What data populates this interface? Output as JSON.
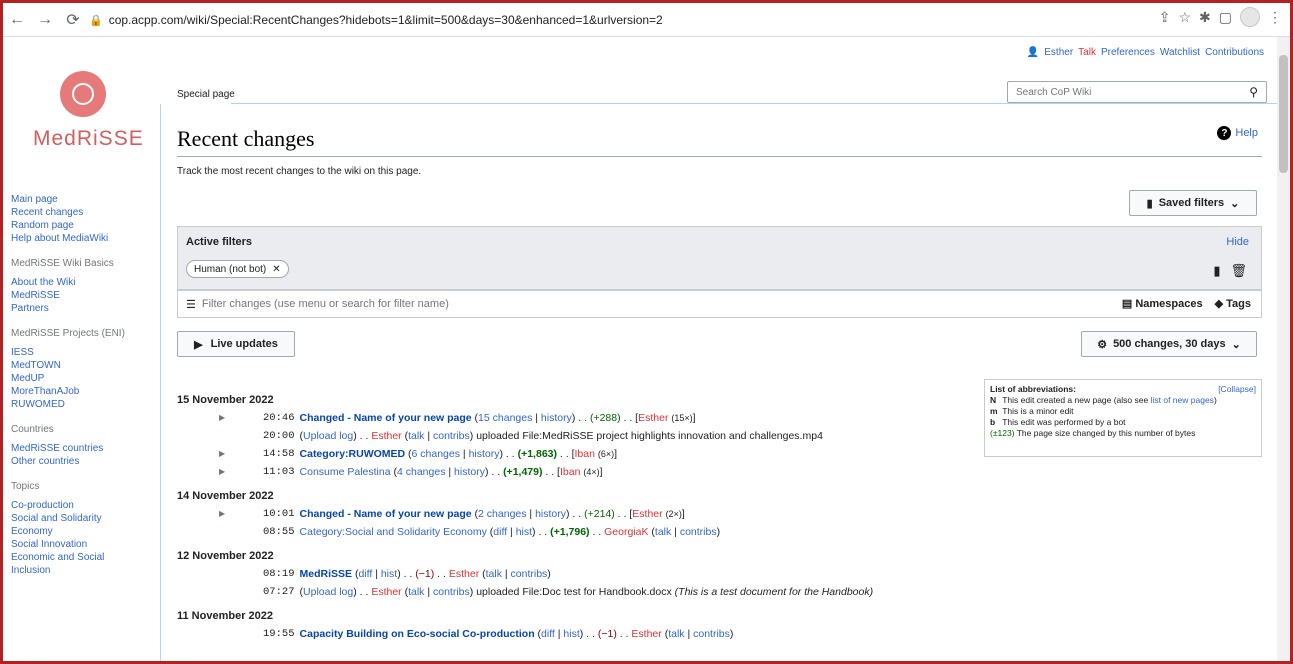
{
  "browser": {
    "url": "cop.acpp.com/wiki/Special:RecentChanges?hidebots=1&limit=500&days=30&enhanced=1&urlversion=2"
  },
  "personal": {
    "user": "Esther",
    "talk": "Talk",
    "preferences": "Preferences",
    "watchlist": "Watchlist",
    "contributions": "Contributions"
  },
  "logo": {
    "text": "MedRiSSE"
  },
  "sidebar": {
    "nav": [
      "Main page",
      "Recent changes",
      "Random page",
      "Help about MediaWiki"
    ],
    "basics_heading": "MedRiSSE Wiki Basics",
    "basics": [
      "About the Wiki",
      "MedRiSSE",
      "Partners"
    ],
    "projects_heading": "MedRiSSE Projects (ENI)",
    "projects": [
      "IESS",
      "MedTOWN",
      "MedUP",
      "MoreThanAJob",
      "RUWOMED"
    ],
    "countries_heading": "Countries",
    "countries": [
      "MedRiSSE countries",
      "Other countries"
    ],
    "topics_heading": "Topics",
    "topics": [
      "Co-production",
      "Social and Solidarity Economy",
      "Social Innovation",
      "Economic and Social Inclusion"
    ]
  },
  "tabs": {
    "special": "Special page"
  },
  "search": {
    "placeholder": "Search CoP Wiki"
  },
  "page": {
    "title": "Recent changes",
    "help": "Help",
    "intro": "Track the most recent changes to the wiki on this page.",
    "saved_filters": "Saved filters",
    "active_filters": "Active filters",
    "hide": "Hide",
    "chip": "Human (not bot)",
    "filter_placeholder": "Filter changes (use menu or search for filter name)",
    "namespaces": "Namespaces",
    "tags": "Tags",
    "live_updates": "Live updates",
    "changes_setting": "500 changes, 30 days"
  },
  "abbrev": {
    "heading": "List of abbreviations:",
    "collapse": "[Collapse]",
    "n_key": "N",
    "n_text": "This edit created a new page (also see",
    "n_link": "list of new pages",
    "m_key": "m",
    "m_text": "This is a minor edit",
    "b_key": "b",
    "b_text": "This edit was performed by a bot",
    "pm_key": "(±123)",
    "pm_text": "The page size changed by this number of bytes"
  },
  "days": [
    {
      "date": "15 November 2022",
      "rows": [
        {
          "time": "20:46",
          "title": "Changed - Name of your new page",
          "changes": "15 changes",
          "history": "history",
          "size": "(+288)",
          "size_class": "pos",
          "user": "Esther",
          "count": "(15×)",
          "expand": true
        },
        {
          "time": "20:00",
          "log": "Upload log",
          "user": "Esther",
          "talk": "talk",
          "contribs": "contribs",
          "action": "uploaded File:MedRiSSE project highlights innovation and challenges.mp4"
        },
        {
          "time": "14:58",
          "title": "Category:RUWOMED",
          "changes": "6 changes",
          "history": "history",
          "size": "(+1,863)",
          "size_class": "posb",
          "user": "Iban",
          "count": "(6×)",
          "expand": true
        },
        {
          "time": "11:03",
          "plain_title": "Consume Palestina",
          "changes": "4 changes",
          "history": "history",
          "size": "(+1,479)",
          "size_class": "posb",
          "user": "Iban",
          "count": "(4×)",
          "expand": true
        }
      ]
    },
    {
      "date": "14 November 2022",
      "rows": [
        {
          "time": "10:01",
          "title": "Changed - Name of your new page",
          "changes": "2 changes",
          "history": "history",
          "size": "(+214)",
          "size_class": "pos",
          "user": "Esther",
          "count": "(2×)",
          "expand": true
        },
        {
          "time": "08:55",
          "plain_title": "Category:Social and Solidarity Economy",
          "diff": "diff",
          "hist": "hist",
          "size": "(+1,796)",
          "size_class": "posb",
          "author": "GeorgiaK",
          "talk": "talk",
          "contribs": "contribs"
        }
      ]
    },
    {
      "date": "12 November 2022",
      "rows": [
        {
          "time": "08:19",
          "title": "MedRiSSE",
          "diff": "diff",
          "hist": "hist",
          "size": "(−1)",
          "size_class": "neg",
          "author": "Esther",
          "talk": "talk",
          "contribs": "contribs"
        },
        {
          "time": "07:27",
          "log": "Upload log",
          "user": "Esther",
          "talk": "talk",
          "contribs": "contribs",
          "action": "uploaded File:Doc test for Handbook.docx",
          "summary": "(This is a test document for the Handbook)"
        }
      ]
    },
    {
      "date": "11 November 2022",
      "rows": [
        {
          "time": "19:55",
          "title": "Capacity Building on Eco-social Co-production",
          "diff": "diff",
          "hist": "hist",
          "size": "(−1)",
          "size_class": "neg",
          "author": "Esther",
          "talk": "talk",
          "contribs": "contribs"
        }
      ]
    }
  ],
  "colors": {
    "link": "#3366cc",
    "red": "#d33",
    "border": "#b22222"
  }
}
